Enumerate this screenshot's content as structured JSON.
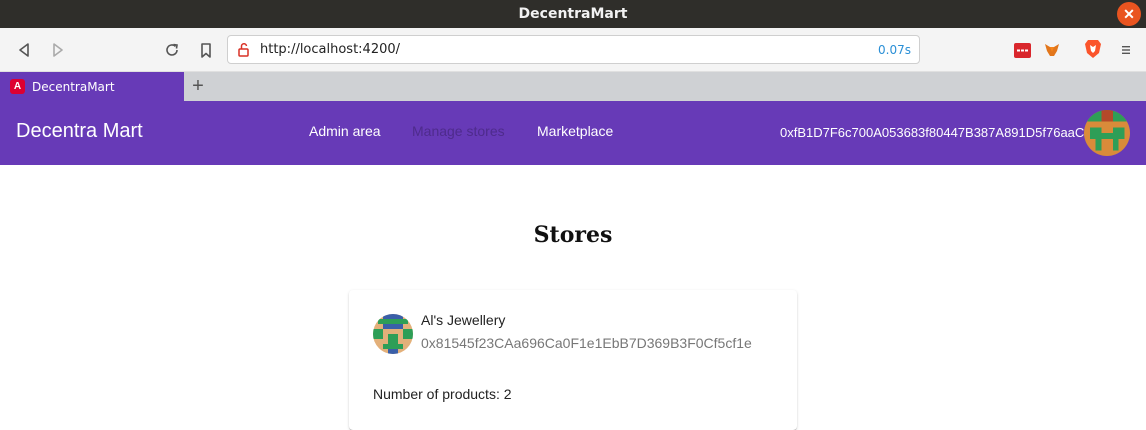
{
  "window": {
    "title": "DecentraMart",
    "close_glyph": "✕"
  },
  "browser": {
    "url": "http://localhost:4200/",
    "timing": "0.07s",
    "tab_title": "DecentraMart",
    "tab_favicon_letter": "A",
    "new_tab_glyph": "+"
  },
  "appbar": {
    "brand": "Decentra Mart",
    "nav": [
      {
        "label": "Admin area"
      },
      {
        "label": "Manage stores"
      },
      {
        "label": "Marketplace"
      }
    ],
    "active_nav_index": 1,
    "account": "0xfB1D7F6c700A053683f80447B387A891D5f76aaC"
  },
  "main": {
    "heading": "Stores",
    "stores": [
      {
        "name": "Al's Jewellery",
        "address": "0x81545f23CAa696Ca0F1e1EbB7D369B3F0Cf5cf1e",
        "product_count_text": "Number of products: 2"
      }
    ]
  },
  "colors": {
    "primary": "#673ab7",
    "active_nav": "#4e2b8c",
    "brave_orange": "#fb542b",
    "close_orange": "#e95420"
  }
}
